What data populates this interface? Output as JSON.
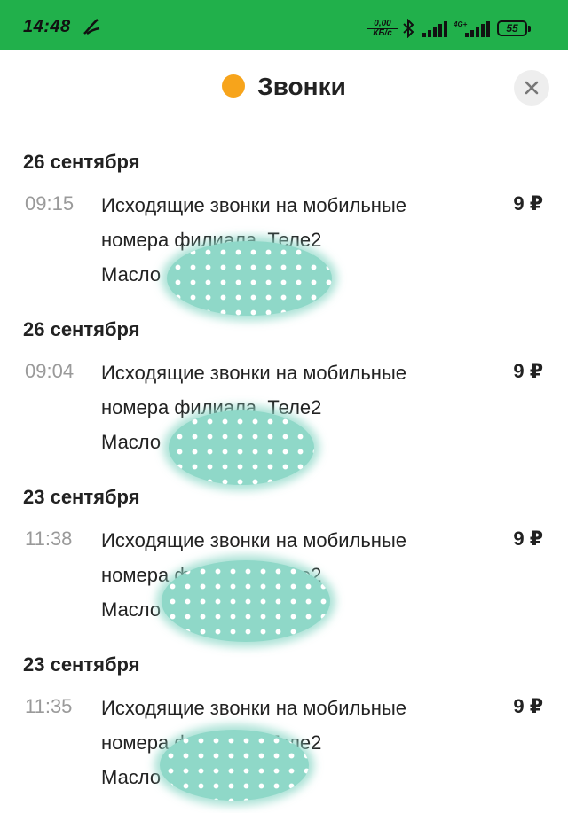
{
  "status_bar": {
    "time": "14:48",
    "speed_value": "0,00",
    "speed_unit": "КБ/с",
    "network": "4G+",
    "battery": "55"
  },
  "header": {
    "title": "Звонки",
    "status_color": "#f7a41b"
  },
  "calls": [
    {
      "date": "26 сентября",
      "time": "09:15",
      "line1": "Исходящие звонки на мобильные",
      "line2": "номера филиала, Теле2",
      "line3": "Масло",
      "price": "9 ₽"
    },
    {
      "date": "26 сентября",
      "time": "09:04",
      "line1": "Исходящие звонки на мобильные",
      "line2": "номера филиала, Теле2",
      "line3": "Масло",
      "price": "9 ₽"
    },
    {
      "date": "23 сентября",
      "time": "11:38",
      "line1": "Исходящие звонки на мобильные",
      "line2": "номера филиала, Теле2",
      "line3": "Масло",
      "price": "9 ₽"
    },
    {
      "date": "23 сентября",
      "time": "11:35",
      "line1": "Исходящие звонки на мобильные",
      "line2": "номера филиала, Теле2",
      "line3": "Масло",
      "price": "9 ₽"
    }
  ],
  "colors": {
    "status_bar": "#21b04b",
    "redaction": "#8fd8c8"
  }
}
